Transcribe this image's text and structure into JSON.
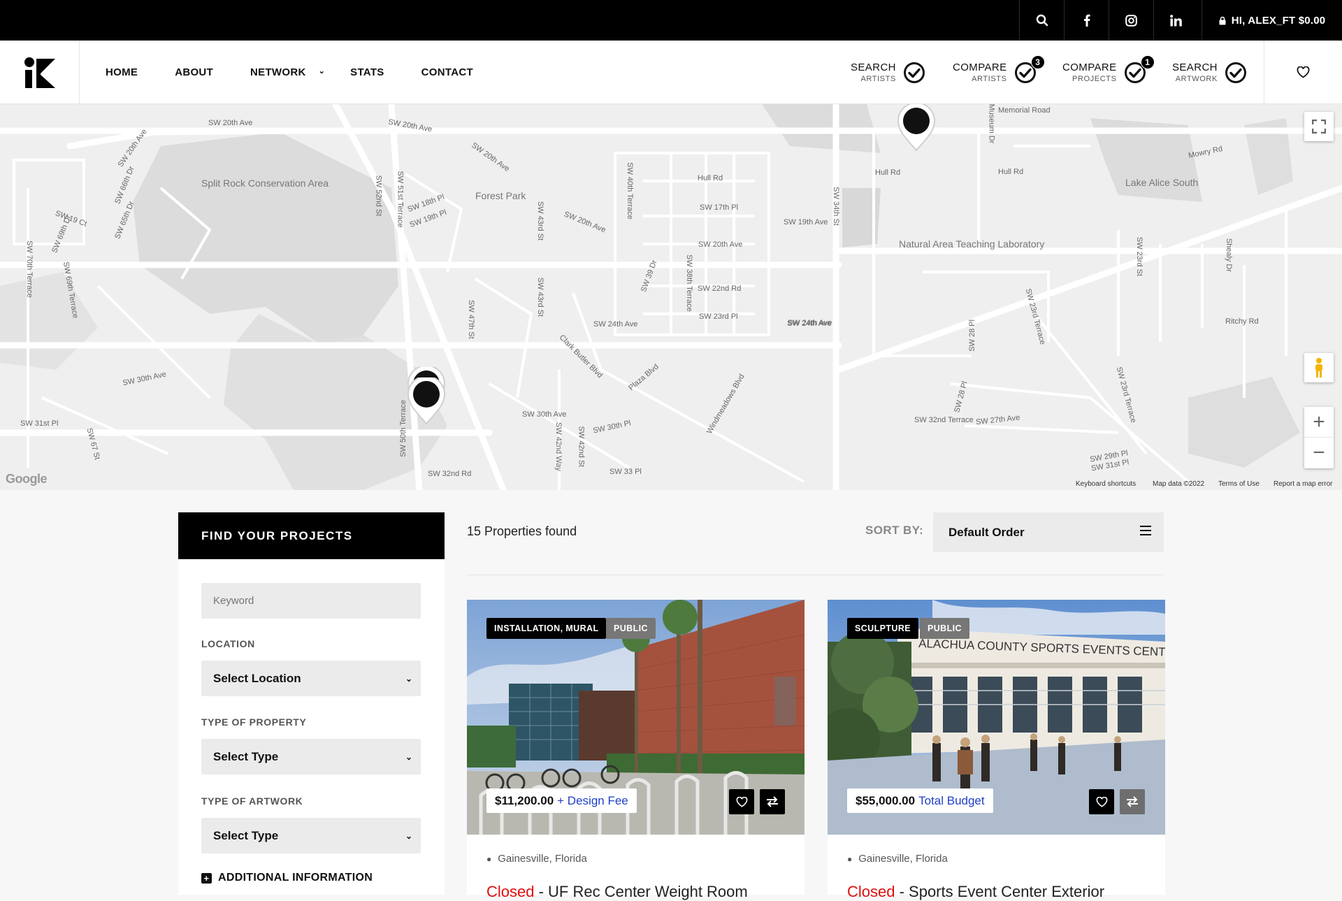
{
  "topbar": {
    "icons": [
      "search-icon",
      "facebook-icon",
      "instagram-icon",
      "linkedin-icon"
    ],
    "user_label": "HI, ALEX_FT $0.00"
  },
  "nav": {
    "items": [
      {
        "label": "HOME"
      },
      {
        "label": "ABOUT"
      },
      {
        "label": "NETWORK",
        "has_dropdown": true
      },
      {
        "label": "STATS"
      },
      {
        "label": "CONTACT"
      }
    ]
  },
  "header_buttons": [
    {
      "line1": "SEARCH",
      "line2": "ARTISTS",
      "badge": ""
    },
    {
      "line1": "COMPARE",
      "line2": "ARTISTS",
      "badge": "3"
    },
    {
      "line1": "COMPARE",
      "line2": "PROJECTS",
      "badge": "1"
    },
    {
      "line1": "SEARCH",
      "line2": "ARTWORK",
      "badge": ""
    }
  ],
  "map": {
    "street_labels": [
      "SW 20th Ave",
      "SW 20th Ave",
      "SW 20th Ave",
      "SW 20th Ave",
      "SW 20th Ave",
      "SW 20th Ave",
      "Split Rock Conservation Area",
      "Forest Park",
      "Hull Rd",
      "SW 17th Pl",
      "SW 19th Ave",
      "SW 34th St",
      "Hull Rd",
      "Hull Rd",
      "Memorial Road",
      "Museum Dr",
      "Mowry Rd",
      "Lake Alice South",
      "Natural Area Teaching Laboratory",
      "SW 22nd Rd",
      "SW 23rd Pl",
      "SW 24th Ave",
      "SW 24th Ave",
      "Ritchy Rd",
      "SW 30th Ave",
      "SW 30th Ave",
      "SW 31st Pl",
      "SW 32nd Rd",
      "SW 33 Pl",
      "SW 30th Pl",
      "SW 32nd Terrace",
      "SW 27th Ave",
      "SW 29th Pl",
      "SW 31st Pl",
      "Clark Butler Blvd",
      "Plaza Blvd",
      "Windmeadows Blvd",
      "SW 24th Ave",
      "SW 19 Ct",
      "SW 18th Pl",
      "SW 19th Pl",
      "SW 52nd St",
      "SW 51st Terrace",
      "SW 43rd St",
      "SW 40th Terrace",
      "SW 39 Dr",
      "SW 38th Terrace",
      "SW 43rd St",
      "SW 47th St",
      "SW 42nd Way",
      "SW 42nd St",
      "SW 50th Terrace",
      "SW 23rd Terrace",
      "SW 23rd St",
      "SW 28 Pl",
      "SW 28 Pl",
      "Shealy Dr",
      "SW 70th Terrace",
      "SW 69th Terrace",
      "SW 67 St",
      "SW 66th Dr",
      "SW 65th Dr",
      "SW 69th Dr",
      "SW 23rd Terrace"
    ],
    "attribution": [
      "Keyboard shortcuts",
      "Map data ©2022",
      "Terms of Use",
      "Report a map error"
    ],
    "brand": "Google"
  },
  "sidebar": {
    "title": "FIND YOUR PROJECTS",
    "keyword_placeholder": "Keyword",
    "location_label": "LOCATION",
    "location_value": "Select Location",
    "property_label": "TYPE OF PROPERTY",
    "property_value": "Select Type",
    "artwork_label": "TYPE OF ARTWORK",
    "artwork_value": "Select Type",
    "additional": "ADDITIONAL INFORMATION"
  },
  "results": {
    "count_text": "15 Properties found",
    "sort_label": "SORT BY:",
    "sort_value": "Default Order"
  },
  "cards": [
    {
      "tag1": "INSTALLATION, MURAL",
      "tag2": "PUBLIC",
      "price": "$11,200.00",
      "price_note": "+ Design Fee",
      "location": "Gainesville, Florida",
      "status": "Closed",
      "title": " - UF Rec Center Weight Room"
    },
    {
      "tag1": "SCULPTURE",
      "tag2": "PUBLIC",
      "price": "$55,000.00",
      "price_note": "Total Budget",
      "location": "Gainesville, Florida",
      "status": "Closed",
      "title": " - Sports Event Center Exterior",
      "sign_text": "ALACHUA COUNTY SPORTS EVENTS CENTE"
    }
  ]
}
